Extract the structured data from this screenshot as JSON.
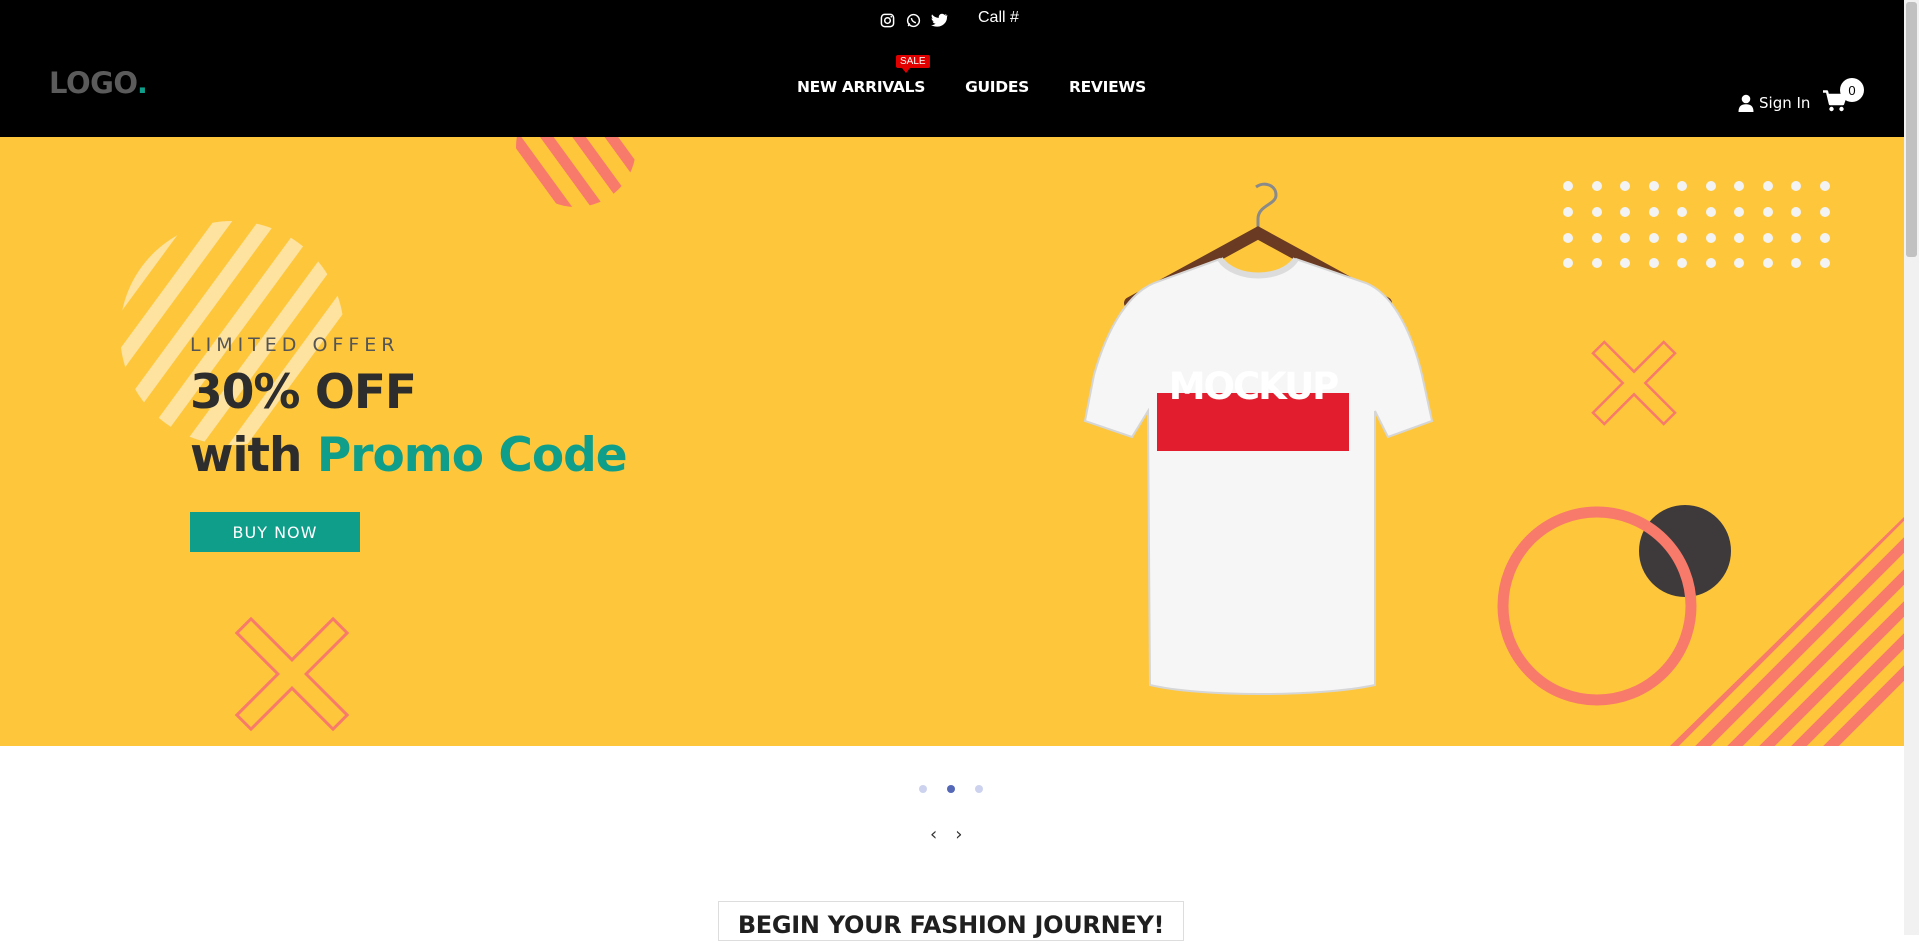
{
  "header": {
    "social_icons": [
      "instagram-icon",
      "whatsapp-icon",
      "twitter-icon"
    ],
    "call_label": "Call #",
    "logo_text": "LOGO",
    "logo_dot": ".",
    "nav": [
      {
        "label": "NEW ARRIVALS"
      },
      {
        "label": "GUIDES"
      },
      {
        "label": "REVIEWS"
      }
    ],
    "sale_badge": "SALE",
    "signin_label": "Sign In",
    "cart_count": "0"
  },
  "hero": {
    "eyebrow": "LIMITED OFFER",
    "headline_line1": "30% OFF",
    "headline_with": "with ",
    "headline_promo": "Promo Code",
    "button_label": "BUY NOW",
    "shirt_text": "MOCKUP"
  },
  "slider": {
    "dot_count": 3,
    "active_dot": 2,
    "prev_icon": "chevron-left-icon",
    "next_icon": "chevron-right-icon"
  },
  "section_title": "BEGIN YOUR FASHION JOURNEY!",
  "colors": {
    "hero_bg": "#fec73b",
    "accent_teal": "#0e9e8a",
    "accent_coral": "#f87a6a",
    "sale_red": "#e00000",
    "header_bg": "#000000"
  }
}
